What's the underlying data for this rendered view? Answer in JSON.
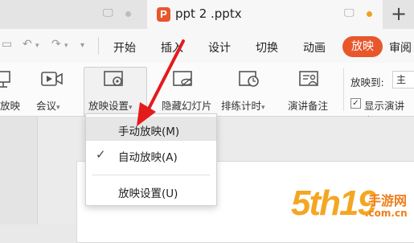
{
  "titlebar": {
    "doc_tab_title": "ppt 2 .pptx",
    "app_logo_letter": "P",
    "new_tab_symbol": "+"
  },
  "menu": {
    "items": [
      "开始",
      "插入",
      "设计",
      "切换",
      "动画",
      "放映",
      "审阅"
    ],
    "active": "放映",
    "active_color": "#e8572c"
  },
  "ribbon": {
    "buttons": [
      {
        "label": "放映",
        "icon": "from-start-icon"
      },
      {
        "label": "会议",
        "icon": "meeting-icon"
      },
      {
        "label": "放映设置",
        "icon": "slideshow-settings-icon"
      },
      {
        "label": "隐藏幻灯片",
        "icon": "hide-slide-icon"
      },
      {
        "label": "排练计时",
        "icon": "rehearse-timing-icon"
      },
      {
        "label": "演讲备注",
        "icon": "speaker-notes-icon"
      }
    ],
    "play_to_label": "放映到:",
    "play_to_value": "主",
    "show_speaker_label": "显示演讲者",
    "show_speaker_checked": true
  },
  "dropdown": {
    "items": [
      {
        "label": "手动放映(M)",
        "checked": false,
        "hovered": true
      },
      {
        "label": "自动放映(A)",
        "checked": true,
        "hovered": false
      },
      {
        "label": "放映设置(U)",
        "checked": false,
        "hovered": false
      }
    ],
    "check_symbol": "✓"
  },
  "watermark": {
    "brand": "5th19",
    "cn_text": "手游网",
    "domain": ".com.cn"
  }
}
